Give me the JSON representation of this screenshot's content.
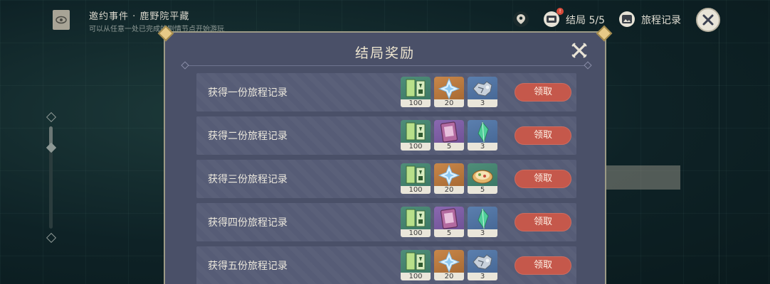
{
  "topbar": {
    "quest_title": "邀约事件 · 鹿野院平藏",
    "quest_subtitle": "可以从任意一处已完成的剧情节点开始游玩",
    "ending_label": "结局 5/5",
    "ending_badge": "!",
    "record_label": "旅程记录"
  },
  "panel": {
    "title": "结局奖励",
    "rows": [
      {
        "label": "获得一份旅程记录",
        "items": [
          {
            "icon": "exp-book-icon",
            "count": "100",
            "rarity": "green"
          },
          {
            "icon": "primogem-icon",
            "count": "20",
            "rarity": "orange"
          },
          {
            "icon": "ore-icon",
            "count": "3",
            "rarity": "blue"
          }
        ],
        "claim": "领取"
      },
      {
        "label": "获得二份旅程记录",
        "items": [
          {
            "icon": "exp-book-icon",
            "count": "100",
            "rarity": "green"
          },
          {
            "icon": "hero-wit-book-icon",
            "count": "5",
            "rarity": "purple"
          },
          {
            "icon": "crystal-icon",
            "count": "3",
            "rarity": "blue"
          }
        ],
        "claim": "领取"
      },
      {
        "label": "获得三份旅程记录",
        "items": [
          {
            "icon": "exp-book-icon",
            "count": "100",
            "rarity": "green"
          },
          {
            "icon": "primogem-icon",
            "count": "20",
            "rarity": "orange"
          },
          {
            "icon": "food-dish-icon",
            "count": "5",
            "rarity": "green"
          }
        ],
        "claim": "领取"
      },
      {
        "label": "获得四份旅程记录",
        "items": [
          {
            "icon": "exp-book-icon",
            "count": "100",
            "rarity": "green"
          },
          {
            "icon": "hero-wit-book-icon",
            "count": "5",
            "rarity": "purple"
          },
          {
            "icon": "crystal-icon",
            "count": "3",
            "rarity": "blue"
          }
        ],
        "claim": "领取"
      },
      {
        "label": "获得五份旅程记录",
        "items": [
          {
            "icon": "exp-book-icon",
            "count": "100",
            "rarity": "green"
          },
          {
            "icon": "primogem-icon",
            "count": "20",
            "rarity": "orange"
          },
          {
            "icon": "ore-icon",
            "count": "3",
            "rarity": "blue"
          }
        ],
        "claim": "领取"
      }
    ]
  },
  "colors": {
    "panel_bg": "#4a5068",
    "row_bg": "#565c76",
    "claim_button": "#c5584b",
    "corner_gold": "#e7c987"
  }
}
